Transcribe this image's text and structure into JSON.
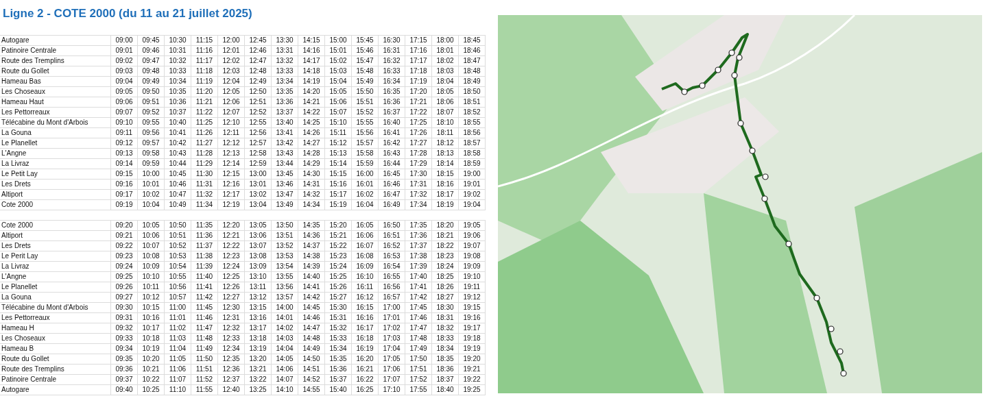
{
  "title": "Ligne 2 - COTE 2000 (du 11 au 21 juillet 2025)",
  "sections": [
    {
      "rows": [
        {
          "stop": "Autogare",
          "times": [
            "09:00",
            "09:45",
            "10:30",
            "11:15",
            "12:00",
            "12:45",
            "13:30",
            "14:15",
            "15:00",
            "15:45",
            "16:30",
            "17:15",
            "18:00",
            "18:45"
          ]
        },
        {
          "stop": "Patinoire Centrale",
          "times": [
            "09:01",
            "09:46",
            "10:31",
            "11:16",
            "12:01",
            "12:46",
            "13:31",
            "14:16",
            "15:01",
            "15:46",
            "16:31",
            "17:16",
            "18:01",
            "18:46"
          ]
        },
        {
          "stop": "Route des Tremplins",
          "times": [
            "09:02",
            "09:47",
            "10:32",
            "11:17",
            "12:02",
            "12:47",
            "13:32",
            "14:17",
            "15:02",
            "15:47",
            "16:32",
            "17:17",
            "18:02",
            "18:47"
          ]
        },
        {
          "stop": "Route du Gollet",
          "times": [
            "09:03",
            "09:48",
            "10:33",
            "11:18",
            "12:03",
            "12:48",
            "13:33",
            "14:18",
            "15:03",
            "15:48",
            "16:33",
            "17:18",
            "18:03",
            "18:48"
          ]
        },
        {
          "stop": "Hameau Bas",
          "times": [
            "09:04",
            "09:49",
            "10:34",
            "11:19",
            "12:04",
            "12:49",
            "13:34",
            "14:19",
            "15:04",
            "15:49",
            "16:34",
            "17:19",
            "18:04",
            "18:49"
          ]
        },
        {
          "stop": "Les Choseaux",
          "times": [
            "09:05",
            "09:50",
            "10:35",
            "11:20",
            "12:05",
            "12:50",
            "13:35",
            "14:20",
            "15:05",
            "15:50",
            "16:35",
            "17:20",
            "18:05",
            "18:50"
          ]
        },
        {
          "stop": "Hameau Haut",
          "times": [
            "09:06",
            "09:51",
            "10:36",
            "11:21",
            "12:06",
            "12:51",
            "13:36",
            "14:21",
            "15:06",
            "15:51",
            "16:36",
            "17:21",
            "18:06",
            "18:51"
          ]
        },
        {
          "stop": "Les Pettorreaux",
          "times": [
            "09:07",
            "09:52",
            "10:37",
            "11:22",
            "12:07",
            "12:52",
            "13:37",
            "14:22",
            "15:07",
            "15:52",
            "16:37",
            "17:22",
            "18:07",
            "18:52"
          ]
        },
        {
          "stop": "Télécabine du Mont d'Arbois",
          "times": [
            "09:10",
            "09:55",
            "10:40",
            "11:25",
            "12:10",
            "12:55",
            "13:40",
            "14:25",
            "15:10",
            "15:55",
            "16:40",
            "17:25",
            "18:10",
            "18:55"
          ]
        },
        {
          "stop": "La Gouna",
          "times": [
            "09:11",
            "09:56",
            "10:41",
            "11:26",
            "12:11",
            "12:56",
            "13:41",
            "14:26",
            "15:11",
            "15:56",
            "16:41",
            "17:26",
            "18:11",
            "18:56"
          ]
        },
        {
          "stop": "Le Planellet",
          "times": [
            "09:12",
            "09:57",
            "10:42",
            "11:27",
            "12:12",
            "12:57",
            "13:42",
            "14:27",
            "15:12",
            "15:57",
            "16:42",
            "17:27",
            "18:12",
            "18:57"
          ]
        },
        {
          "stop": "L'Angne",
          "times": [
            "09:13",
            "09:58",
            "10:43",
            "11:28",
            "12:13",
            "12:58",
            "13:43",
            "14:28",
            "15:13",
            "15:58",
            "16:43",
            "17:28",
            "18:13",
            "18:58"
          ]
        },
        {
          "stop": "La Livraz",
          "times": [
            "09:14",
            "09:59",
            "10:44",
            "11:29",
            "12:14",
            "12:59",
            "13:44",
            "14:29",
            "15:14",
            "15:59",
            "16:44",
            "17:29",
            "18:14",
            "18:59"
          ]
        },
        {
          "stop": "Le Petit Lay",
          "times": [
            "09:15",
            "10:00",
            "10:45",
            "11:30",
            "12:15",
            "13:00",
            "13:45",
            "14:30",
            "15:15",
            "16:00",
            "16:45",
            "17:30",
            "18:15",
            "19:00"
          ]
        },
        {
          "stop": "Les Drets",
          "times": [
            "09:16",
            "10:01",
            "10:46",
            "11:31",
            "12:16",
            "13:01",
            "13:46",
            "14:31",
            "15:16",
            "16:01",
            "16:46",
            "17:31",
            "18:16",
            "19:01"
          ]
        },
        {
          "stop": "Altiport",
          "times": [
            "09:17",
            "10:02",
            "10:47",
            "11:32",
            "12:17",
            "13:02",
            "13:47",
            "14:32",
            "15:17",
            "16:02",
            "16:47",
            "17:32",
            "18:17",
            "19:02"
          ]
        },
        {
          "stop": "Cote 2000",
          "times": [
            "09:19",
            "10:04",
            "10:49",
            "11:34",
            "12:19",
            "13:04",
            "13:49",
            "14:34",
            "15:19",
            "16:04",
            "16:49",
            "17:34",
            "18:19",
            "19:04"
          ]
        }
      ]
    },
    {
      "rows": [
        {
          "stop": "Cote 2000",
          "times": [
            "09:20",
            "10:05",
            "10:50",
            "11:35",
            "12:20",
            "13:05",
            "13:50",
            "14:35",
            "15:20",
            "16:05",
            "16:50",
            "17:35",
            "18:20",
            "19:05"
          ]
        },
        {
          "stop": "Altiport",
          "times": [
            "09:21",
            "10:06",
            "10:51",
            "11:36",
            "12:21",
            "13:06",
            "13:51",
            "14:36",
            "15:21",
            "16:06",
            "16:51",
            "17:36",
            "18:21",
            "19:06"
          ]
        },
        {
          "stop": "Les Drets",
          "times": [
            "09:22",
            "10:07",
            "10:52",
            "11:37",
            "12:22",
            "13:07",
            "13:52",
            "14:37",
            "15:22",
            "16:07",
            "16:52",
            "17:37",
            "18:22",
            "19:07"
          ]
        },
        {
          "stop": "Le Perit Lay",
          "times": [
            "09:23",
            "10:08",
            "10:53",
            "11:38",
            "12:23",
            "13:08",
            "13:53",
            "14:38",
            "15:23",
            "16:08",
            "16:53",
            "17:38",
            "18:23",
            "19:08"
          ]
        },
        {
          "stop": "La Livraz",
          "times": [
            "09:24",
            "10:09",
            "10:54",
            "11:39",
            "12:24",
            "13:09",
            "13:54",
            "14:39",
            "15:24",
            "16:09",
            "16:54",
            "17:39",
            "18:24",
            "19:09"
          ]
        },
        {
          "stop": "L'Angne",
          "times": [
            "09:25",
            "10:10",
            "10:55",
            "11:40",
            "12:25",
            "13:10",
            "13:55",
            "14:40",
            "15:25",
            "16:10",
            "16:55",
            "17:40",
            "18:25",
            "19:10"
          ]
        },
        {
          "stop": "Le Planellet",
          "times": [
            "09:26",
            "10:11",
            "10:56",
            "11:41",
            "12:26",
            "13:11",
            "13:56",
            "14:41",
            "15:26",
            "16:11",
            "16:56",
            "17:41",
            "18:26",
            "19:11"
          ]
        },
        {
          "stop": "La Gouna",
          "times": [
            "09:27",
            "10:12",
            "10:57",
            "11:42",
            "12:27",
            "13:12",
            "13:57",
            "14:42",
            "15:27",
            "16:12",
            "16:57",
            "17:42",
            "18:27",
            "19:12"
          ]
        },
        {
          "stop": "Télécabine du Mont d'Arbois",
          "times": [
            "09:30",
            "10:15",
            "11:00",
            "11:45",
            "12:30",
            "13:15",
            "14:00",
            "14:45",
            "15:30",
            "16:15",
            "17:00",
            "17:45",
            "18:30",
            "19:15"
          ]
        },
        {
          "stop": "Les Pettorreaux",
          "times": [
            "09:31",
            "10:16",
            "11:01",
            "11:46",
            "12:31",
            "13:16",
            "14:01",
            "14:46",
            "15:31",
            "16:16",
            "17:01",
            "17:46",
            "18:31",
            "19:16"
          ]
        },
        {
          "stop": "Hameau H",
          "times": [
            "09:32",
            "10:17",
            "11:02",
            "11:47",
            "12:32",
            "13:17",
            "14:02",
            "14:47",
            "15:32",
            "16:17",
            "17:02",
            "17:47",
            "18:32",
            "19:17"
          ]
        },
        {
          "stop": "Les Choseaux",
          "times": [
            "09:33",
            "10:18",
            "11:03",
            "11:48",
            "12:33",
            "13:18",
            "14:03",
            "14:48",
            "15:33",
            "16:18",
            "17:03",
            "17:48",
            "18:33",
            "19:18"
          ]
        },
        {
          "stop": "Hameau B",
          "times": [
            "09:34",
            "10:19",
            "11:04",
            "11:49",
            "12:34",
            "13:19",
            "14:04",
            "14:49",
            "15:34",
            "16:19",
            "17:04",
            "17:49",
            "18:34",
            "19:19"
          ]
        },
        {
          "stop": "Route du Gollet",
          "times": [
            "09:35",
            "10:20",
            "11:05",
            "11:50",
            "12:35",
            "13:20",
            "14:05",
            "14:50",
            "15:35",
            "16:20",
            "17:05",
            "17:50",
            "18:35",
            "19:20"
          ]
        },
        {
          "stop": "Route des Tremplins",
          "times": [
            "09:36",
            "10:21",
            "11:06",
            "11:51",
            "12:36",
            "13:21",
            "14:06",
            "14:51",
            "15:36",
            "16:21",
            "17:06",
            "17:51",
            "18:36",
            "19:21"
          ]
        },
        {
          "stop": "Patinoire Centrale",
          "times": [
            "09:37",
            "10:22",
            "11:07",
            "11:52",
            "12:37",
            "13:22",
            "14:07",
            "14:52",
            "15:37",
            "16:22",
            "17:07",
            "17:52",
            "18:37",
            "19:22"
          ]
        },
        {
          "stop": "Autogare",
          "times": [
            "09:40",
            "10:25",
            "11:10",
            "11:55",
            "12:40",
            "13:25",
            "14:10",
            "14:55",
            "15:40",
            "16:25",
            "17:10",
            "17:55",
            "18:40",
            "19:25"
          ]
        }
      ]
    }
  ]
}
